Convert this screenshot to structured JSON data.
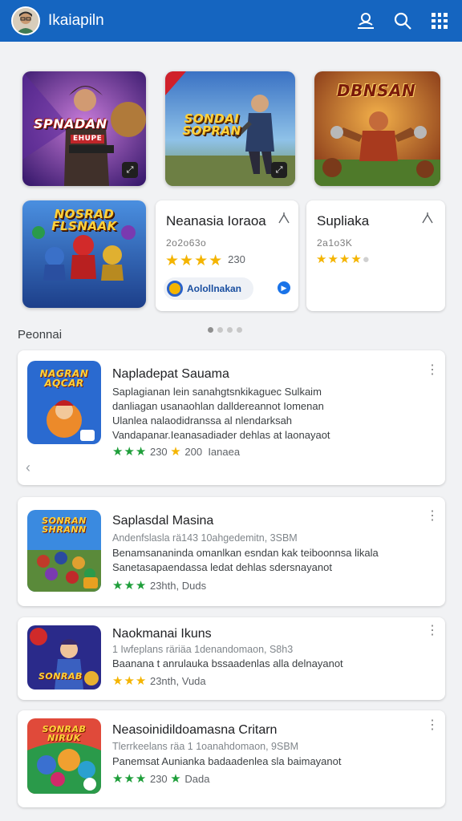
{
  "appbar": {
    "title": "Ikaiapiln",
    "icons": [
      "avatar",
      "account-badge-icon",
      "search-icon",
      "grid-icon"
    ],
    "color": "#1565c0"
  },
  "tiles": [
    {
      "label": "SPNADAN",
      "sublabel": "EHUPE",
      "icon": "fullscreen-icon"
    },
    {
      "label": "SONDAI SOPRAN",
      "icon": "fullscreen-icon"
    },
    {
      "label": "DBNSAN"
    },
    {
      "label": "NOSRAD FLSNAAK"
    }
  ],
  "mini_cards": [
    {
      "title": "Neanasia Ioraoa",
      "meta": "2o2o63o",
      "rating_text": "230",
      "chip": "Aolollnakan",
      "share_icon": "share-icon"
    },
    {
      "title": "Supliaka",
      "meta": "2a1o3K",
      "share_icon": "share-icon"
    }
  ],
  "carousel": {
    "pages": 4,
    "active": 1
  },
  "section": {
    "title": "Peonnai"
  },
  "list": [
    {
      "title": "Napladepat Sauama",
      "lines": [
        "Saplagianan lein sanahgtsnkikaguec Sulkaim",
        "danliagan usanaohlan dalldereannot Iomenan",
        "Ulanlea nalaodidranssa al nlendarksah",
        "Vandapanar.Ieanasadiader dehlas at laonayaot"
      ],
      "rating": "230",
      "rating2": "200",
      "rating_suffix": "Ianaea",
      "thumb_label": "NAGRAN AQCAR"
    },
    {
      "title": "Saplasdal Masina",
      "meta": "Andenfslasla rä143  10ahgedemitn, 3SBM",
      "lines": [
        "Benamsananinda omanlkan esndan kak teiboonnsa likala",
        "Sanetasapaendassa ledat dehlas sdersnayanot"
      ],
      "rating": "23hth,",
      "rating_suffix": "Duds",
      "thumb_label": "SONRAN SHRANN"
    },
    {
      "title": "Naokmanai Ikuns",
      "meta": "1 Iwfeplans räriäa  1denandomaon, S8h3",
      "lines": [
        "Baanana t anrulauka bssaadenlas alla delnayanot"
      ],
      "rating": "23nth,",
      "rating_suffix": "Vuda",
      "thumb_label": "SONRAB"
    },
    {
      "title": "Neasoinidildoamasna Critarn",
      "meta": "Tlerrkeelans räa 1 1oanahdomaon, 9SBM",
      "lines": [
        "Panemsat Aunianka badaadenlea sla baimayanot"
      ],
      "rating": "230",
      "rating_suffix": "Dada",
      "thumb_label": "SONRAB NIRUK"
    }
  ],
  "colors": {
    "star_yellow": "#f4b400",
    "star_green": "#1e9e3a",
    "accent": "#1a73e8"
  }
}
